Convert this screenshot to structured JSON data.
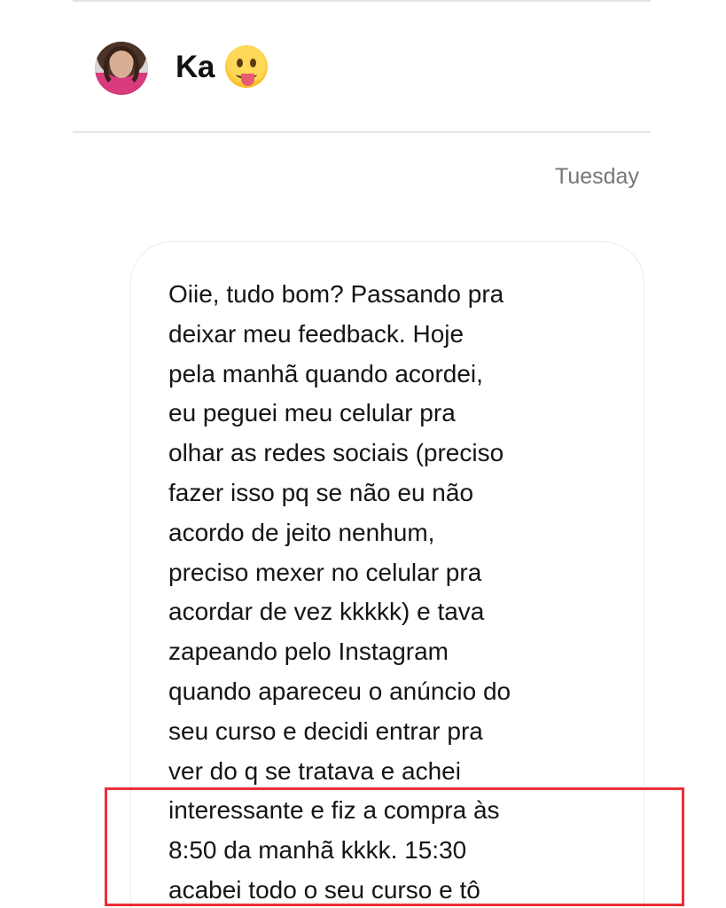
{
  "conversation": {
    "contact": {
      "name": "Ka",
      "emoji": "😛",
      "avatar_icon": "profile-photo"
    },
    "date_label": "Tuesday",
    "message": {
      "text": "Oiie, tudo bom? Passando pra\ndeixar meu feedback. Hoje\npela manhã quando acordei,\neu peguei meu celular pra\nolhar as redes sociais (preciso\nfazer isso pq se não eu não\nacordo de jeito nenhum,\npreciso mexer no celular pra\nacordar de vez kkkkk) e tava\nzapeando pelo Instagram\nquando apareceu o anúncio do\nseu curso e decidi entrar pra\nver do q se tratava e achei\ninteressante e fiz a compra às\n8:50 da manhã kkkk. 15:30\nacabei todo o seu curso e tô"
    }
  },
  "colors": {
    "highlight": "#ea2f35",
    "divider": "#e5e5e5",
    "muted_text": "#777777",
    "bubble_border": "#ececec"
  }
}
